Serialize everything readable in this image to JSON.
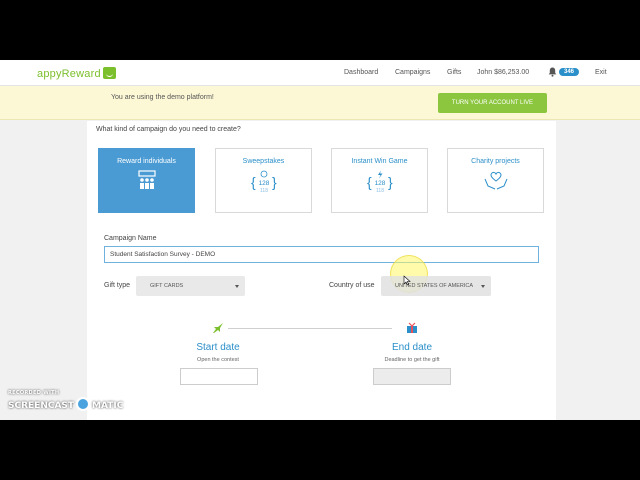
{
  "logo": {
    "text": "appyReward"
  },
  "nav": {
    "dashboard": "Dashboard",
    "campaigns": "Campaigns",
    "gifts": "Gifts",
    "user": "John $86,253.00",
    "notification_count": "346",
    "exit": "Exit"
  },
  "banner": {
    "text": "You are using the demo platform!",
    "button": "TURN YOUR ACCOUNT LIVE"
  },
  "question": "What kind of campaign do you need to create?",
  "campaign_types": [
    {
      "label": "Reward individuals",
      "icon": "people-group-icon",
      "selected": true
    },
    {
      "label": "Sweepstakes",
      "icon": "sweepstakes-128-icon",
      "selected": false
    },
    {
      "label": "Instant Win Game",
      "icon": "instant-win-128-icon",
      "selected": false
    },
    {
      "label": "Charity projects",
      "icon": "heart-hands-icon",
      "selected": false
    }
  ],
  "card_glyph": {
    "big": "128",
    "small": "118"
  },
  "campaign_name": {
    "label": "Campaign Name",
    "value": "Student Satisfaction Survey - DEMO"
  },
  "gift_type": {
    "label": "Gift type",
    "value": "GIFT CARDS"
  },
  "country": {
    "label": "Country of use",
    "value": "UNITED STATES OF AMERICA"
  },
  "start": {
    "title": "Start date",
    "subtitle": "Open the contest"
  },
  "end": {
    "title": "End date",
    "subtitle": "Deadline to get the gift"
  },
  "watermark": {
    "top": "RECORDED WITH",
    "left": "SCREENCAST",
    "right": "MATIC"
  },
  "colors": {
    "accent": "#2b8fc9",
    "selected_card": "#4a9bd4",
    "brand_green": "#8cc63f",
    "banner_bg": "#fcf8d6"
  }
}
